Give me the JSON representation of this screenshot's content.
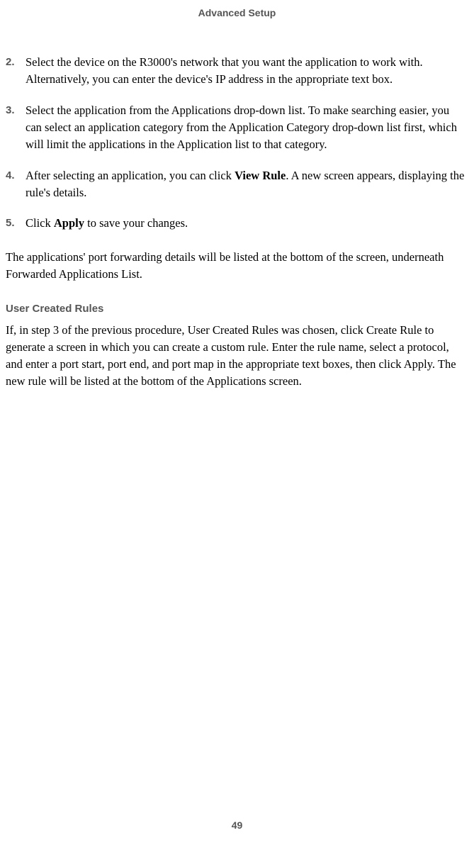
{
  "header": "Advanced Setup",
  "steps": [
    {
      "num": "2.",
      "text": "Select the device on the R3000's network that you want the application to work with. Alternatively, you can enter the device's IP address in the appropriate text box."
    },
    {
      "num": "3.",
      "text": "Select the application from the Applications drop-down list. To make searching easier, you can select an application category from the Application Category drop-down list first, which will limit the applications in the Application list to that category."
    },
    {
      "num": "4.",
      "text_before": "After selecting an application, you can click ",
      "bold1": "View Rule",
      "text_after": ". A new screen appears, displaying the rule's details."
    },
    {
      "num": "5.",
      "text_before": "Click ",
      "bold1": "Apply",
      "text_after": " to save your changes."
    }
  ],
  "after_steps": "The applications' port forwarding details will be listed at the bottom of the screen, underneath Forwarded Applications List.",
  "section_heading": "User Created Rules",
  "section_body": "If, in step 3 of the previous procedure, User Created Rules was chosen, click Create Rule to generate a screen in which you can create a custom rule. Enter the rule name, select a protocol, and enter a port start, port end, and port map in the appropriate text boxes, then click Apply. The new rule will be listed at the bottom of the Applications screen.",
  "page_number": "49"
}
